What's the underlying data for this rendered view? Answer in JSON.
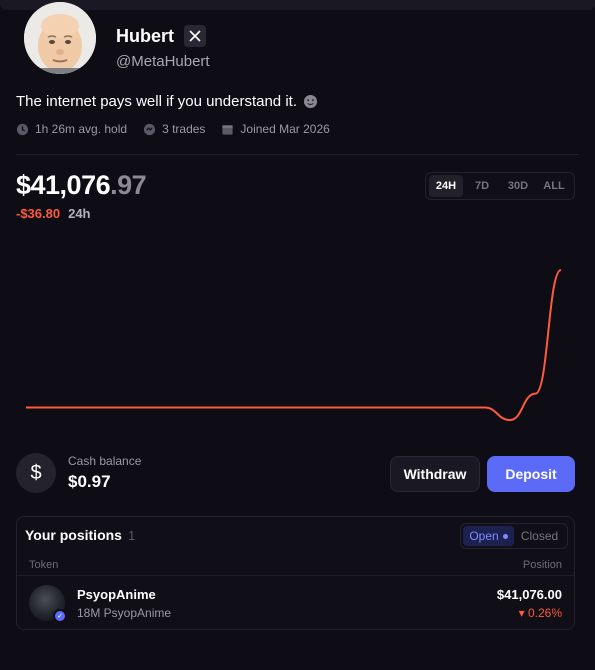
{
  "profile": {
    "name": "Hubert",
    "handle": "@MetaHubert",
    "bio": "The internet pays well if you understand it.",
    "bio_emoji": "slight-smile",
    "avg_hold": "1h 26m avg. hold",
    "trades": "3 trades",
    "joined": "Joined Mar 2026"
  },
  "portfolio": {
    "value_main": "$41,076",
    "value_decimal": ".97",
    "change": "-$36.80",
    "period": "24h",
    "range_tabs": [
      "24H",
      "7D",
      "30D",
      "ALL"
    ],
    "active_range": "24H"
  },
  "chart_data": {
    "type": "line",
    "series": [
      {
        "values": [
          0,
          0,
          0,
          0,
          0,
          0,
          0,
          0,
          0,
          0,
          0,
          0,
          0,
          0,
          0,
          0,
          0,
          0,
          0,
          -0.9,
          1.0,
          9.9
        ]
      }
    ],
    "color": "#ff5a3c"
  },
  "cash": {
    "label": "Cash balance",
    "value": "$0.97",
    "withdraw_label": "Withdraw",
    "deposit_label": "Deposit"
  },
  "positions": {
    "title": "Your positions",
    "count": "1",
    "tab_open": "Open",
    "tab_closed": "Closed",
    "col_token": "Token",
    "col_position": "Position",
    "items": [
      {
        "name": "PsyopAnime",
        "sub": "18M PsyopAnime",
        "value": "$41,076.00",
        "change": "▾ 0.26%"
      }
    ]
  },
  "colors": {
    "accent": "#5b6bf8",
    "negative": "#ff5a3c",
    "background": "#0e0c14"
  }
}
